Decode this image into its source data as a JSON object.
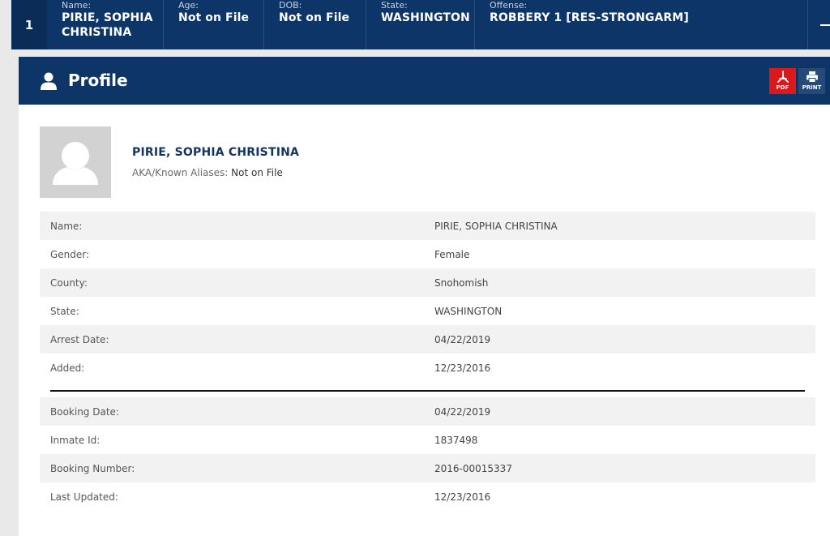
{
  "topbar": {
    "index": "1",
    "cells": [
      {
        "label": "Name:",
        "value": "PIRIE, SOPHIA CHRISTINA"
      },
      {
        "label": "Age:",
        "value": "Not on File"
      },
      {
        "label": "DOB:",
        "value": "Not on File"
      },
      {
        "label": "State:",
        "value": "WASHINGTON"
      },
      {
        "label": "Offense:",
        "value": "ROBBERY 1 [RES-STRONGARM]"
      }
    ]
  },
  "panel": {
    "title": "Profile",
    "pdf_label": "PDF",
    "print_label": "PRINT",
    "person_name": "PIRIE, SOPHIA CHRISTINA",
    "aka_label": "AKA/Known Aliases:",
    "aka_value": "Not on File"
  },
  "details": [
    {
      "key": "Name:",
      "value": "PIRIE, SOPHIA CHRISTINA"
    },
    {
      "key": "Gender:",
      "value": "Female"
    },
    {
      "key": "County:",
      "value": "Snohomish"
    },
    {
      "key": "State:",
      "value": "WASHINGTON"
    },
    {
      "key": "Arrest Date:",
      "value": "04/22/2019"
    },
    {
      "key": "Added:",
      "value": "12/23/2016"
    }
  ],
  "booking": [
    {
      "key": "Booking Date:",
      "value": "04/22/2019"
    },
    {
      "key": "Inmate Id:",
      "value": "1837498"
    },
    {
      "key": "Booking Number:",
      "value": "2016-00015337"
    },
    {
      "key": "Last Updated:",
      "value": "12/23/2016"
    }
  ],
  "colors": {
    "navy": "#0d3568",
    "pdf_red": "#d9191c"
  }
}
